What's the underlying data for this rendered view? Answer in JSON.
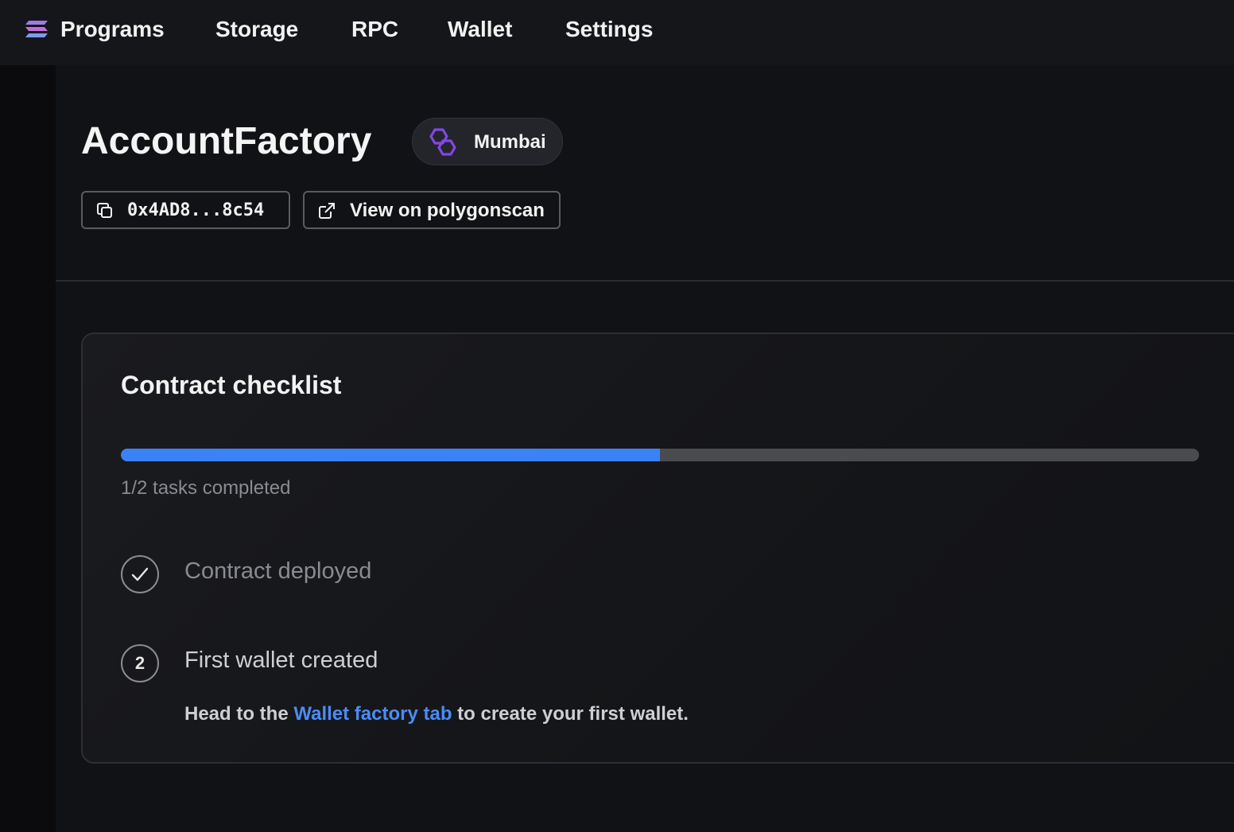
{
  "nav": {
    "items": [
      {
        "label": "Programs"
      },
      {
        "label": "Storage"
      },
      {
        "label": "RPC"
      },
      {
        "label": "Wallet"
      },
      {
        "label": "Settings"
      }
    ]
  },
  "header": {
    "title": "AccountFactory",
    "chain": {
      "name": "Mumbai",
      "icon": "polygon-icon"
    },
    "address": "0x4AD8...8c54",
    "explorer_label": "View on polygonscan"
  },
  "checklist": {
    "title": "Contract checklist",
    "progress": {
      "completed": 1,
      "total": 2,
      "fraction": 0.5,
      "label": "1/2 tasks completed"
    },
    "steps": [
      {
        "label": "Contract deployed",
        "status": "done"
      },
      {
        "number": "2",
        "label": "First wallet created",
        "status": "pending",
        "description_prefix": "Head to the ",
        "description_link": "Wallet factory tab",
        "description_suffix": " to create your first wallet."
      }
    ]
  },
  "colors": {
    "accent": "#3b82f6",
    "link": "#4a8cf7",
    "polygon": "#8247e5"
  }
}
